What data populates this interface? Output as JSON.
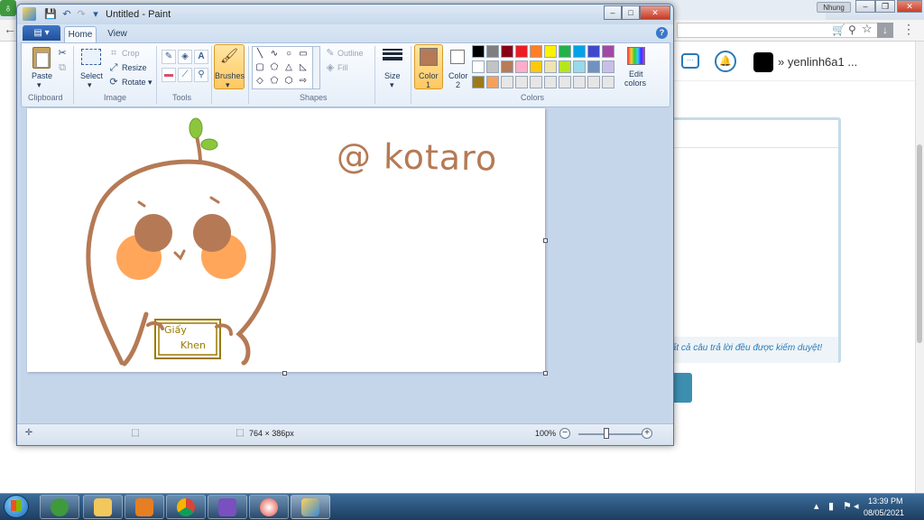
{
  "browser": {
    "user_badge": "Nhung",
    "site_username": "yenlinh6a1 ...",
    "username_prefix": "»",
    "moderation_note": "tất cả câu trả lời đều được kiểm duyệt!"
  },
  "paint": {
    "title": "Untitled - Paint",
    "tabs": [
      {
        "label": "Home",
        "active": true
      },
      {
        "label": "View",
        "active": false
      }
    ],
    "clipboard": {
      "paste": "Paste",
      "group": "Clipboard"
    },
    "image": {
      "select": "Select",
      "crop": "Crop",
      "resize": "Resize",
      "rotate": "Rotate",
      "group": "Image"
    },
    "tools": {
      "group": "Tools"
    },
    "brushes": {
      "label": "Brushes"
    },
    "shapes": {
      "outline": "Outline",
      "fill": "Fill",
      "group": "Shapes"
    },
    "size": {
      "label": "Size"
    },
    "colors": {
      "color1_label": "Color",
      "color1_num": "1",
      "color2_label": "Color",
      "color2_num": "2",
      "edit_label": "Edit",
      "edit_label2": "colors",
      "group": "Colors",
      "color1_value": "#b57a55",
      "color2_value": "#ffffff",
      "palette": [
        "#000000",
        "#7f7f7f",
        "#880015",
        "#ed1c24",
        "#ff7f27",
        "#fff200",
        "#22b14c",
        "#00a2e8",
        "#3f48cc",
        "#a349a4",
        "#ffffff",
        "#c3c3c3",
        "#b97a57",
        "#ffaec9",
        "#ffc90e",
        "#efe4b0",
        "#b5e61d",
        "#99d9ea",
        "#7092be",
        "#c8bfe7",
        "#9c7a1a",
        "#f5a15b",
        "#e6e6e6",
        "#e6e6e6",
        "#e6e6e6",
        "#e6e6e6",
        "#e6e6e6",
        "#e6e6e6",
        "#e6e6e6",
        "#e6e6e6"
      ]
    },
    "canvas": {
      "watermark": "@ kotaro",
      "paper_line1": "Giấy",
      "paper_line2": "Khen"
    },
    "status": {
      "dimensions": "764 × 386px",
      "zoom": "100%"
    }
  },
  "taskbar": {
    "time": "13:39 PM",
    "date": "08/05/2021"
  }
}
